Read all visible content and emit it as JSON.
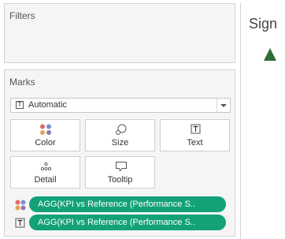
{
  "filters": {
    "title": "Filters"
  },
  "marks": {
    "title": "Marks",
    "mark_type": "Automatic",
    "buttons": [
      {
        "label": "Color",
        "icon": "color-dots-icon"
      },
      {
        "label": "Size",
        "icon": "size-icon"
      },
      {
        "label": "Text",
        "icon": "text-icon"
      },
      {
        "label": "Detail",
        "icon": "detail-icon"
      },
      {
        "label": "Tooltip",
        "icon": "tooltip-icon"
      }
    ],
    "fields": [
      {
        "label": "AGG(KPI vs Reference (Performance S..",
        "icon": "color-dots-icon"
      },
      {
        "label": "AGG(KPI vs Reference (Performance S..",
        "icon": "text-icon"
      }
    ]
  },
  "view": {
    "title": "Sign"
  },
  "colors": {
    "pill": "#13a178",
    "triangle": "#2e6b3a"
  }
}
